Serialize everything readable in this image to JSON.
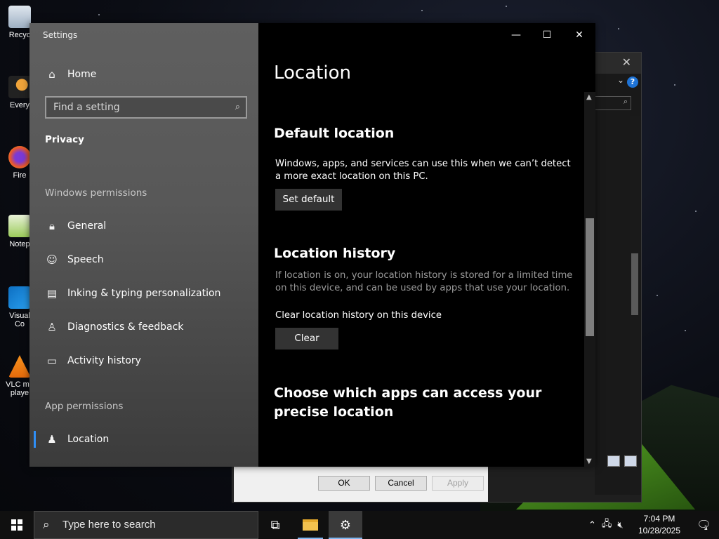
{
  "desktop": {
    "icons": [
      {
        "label": "Recyc",
        "icon": "recycle-bin-icon"
      },
      {
        "label": "Every",
        "icon": "everything-search-icon"
      },
      {
        "label": "Fire",
        "icon": "firefox-icon"
      },
      {
        "label": "Notep",
        "icon": "notepad-icon"
      },
      {
        "label": "Visual",
        "label2": "Co",
        "icon": "vscode-icon"
      },
      {
        "label": "VLC me",
        "label2": "playe",
        "icon": "vlc-icon"
      }
    ]
  },
  "background_dialog": {
    "ok_label": "OK",
    "cancel_label": "Cancel",
    "apply_label": "Apply",
    "help_label": "?"
  },
  "settings": {
    "window_title": "Settings",
    "controls": {
      "minimize": "—",
      "maximize": "☐",
      "close": "✕"
    },
    "sidebar": {
      "home_label": "Home",
      "search_placeholder": "Find a setting",
      "category": "Privacy",
      "windows_permissions_header": "Windows permissions",
      "windows_permissions": [
        {
          "label": "General",
          "icon": "lock-icon"
        },
        {
          "label": "Speech",
          "icon": "speech-icon"
        },
        {
          "label": "Inking & typing personalization",
          "icon": "inking-icon"
        },
        {
          "label": "Diagnostics & feedback",
          "icon": "diagnostics-icon"
        },
        {
          "label": "Activity history",
          "icon": "activity-history-icon"
        }
      ],
      "app_permissions_header": "App permissions",
      "app_permissions": [
        {
          "label": "Location",
          "icon": "location-icon",
          "active": true
        }
      ]
    },
    "content": {
      "page_title": "Location",
      "default_location": {
        "heading": "Default location",
        "description": "Windows, apps, and services can use this when we can’t detect a more exact location on this PC.",
        "button": "Set default"
      },
      "location_history": {
        "heading": "Location history",
        "description": "If location is on, your location history is stored for a limited time on this device, and can be used by apps that use your location.",
        "clear_label": "Clear location history on this device",
        "button": "Clear"
      },
      "precise_location": {
        "heading": "Choose which apps can access your precise location"
      }
    }
  },
  "taskbar": {
    "search_placeholder": "Type here to search",
    "time": "7:04 PM",
    "date": "10/28/2025",
    "notification_count": "1"
  }
}
